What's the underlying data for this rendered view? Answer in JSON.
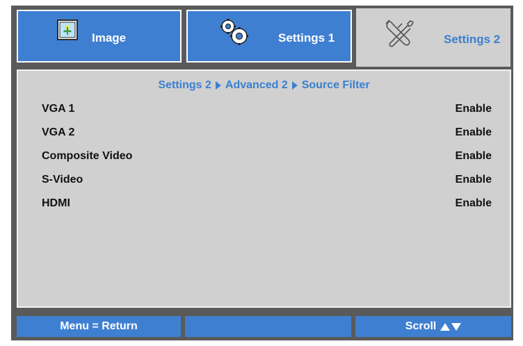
{
  "tabs": {
    "image": {
      "label": "Image",
      "icon": "image-icon"
    },
    "settings1": {
      "label": "Settings 1",
      "icon": "gears-icon"
    },
    "settings2": {
      "label": "Settings 2",
      "icon": "tools-icon",
      "active": true
    }
  },
  "breadcrumb": {
    "items": [
      "Settings 2",
      "Advanced 2",
      "Source Filter"
    ]
  },
  "rows": [
    {
      "name": "VGA 1",
      "value": "Enable"
    },
    {
      "name": "VGA 2",
      "value": "Enable"
    },
    {
      "name": "Composite Video",
      "value": "Enable"
    },
    {
      "name": "S-Video",
      "value": "Enable"
    },
    {
      "name": "HDMI",
      "value": "Enable"
    }
  ],
  "bottom": {
    "menu_label": "Menu = Return",
    "empty_label": "",
    "scroll_label": "Scroll"
  },
  "colors": {
    "accent": "#3f7fd1",
    "panel": "#d0d0d0",
    "frame": "#5a5a5a"
  }
}
